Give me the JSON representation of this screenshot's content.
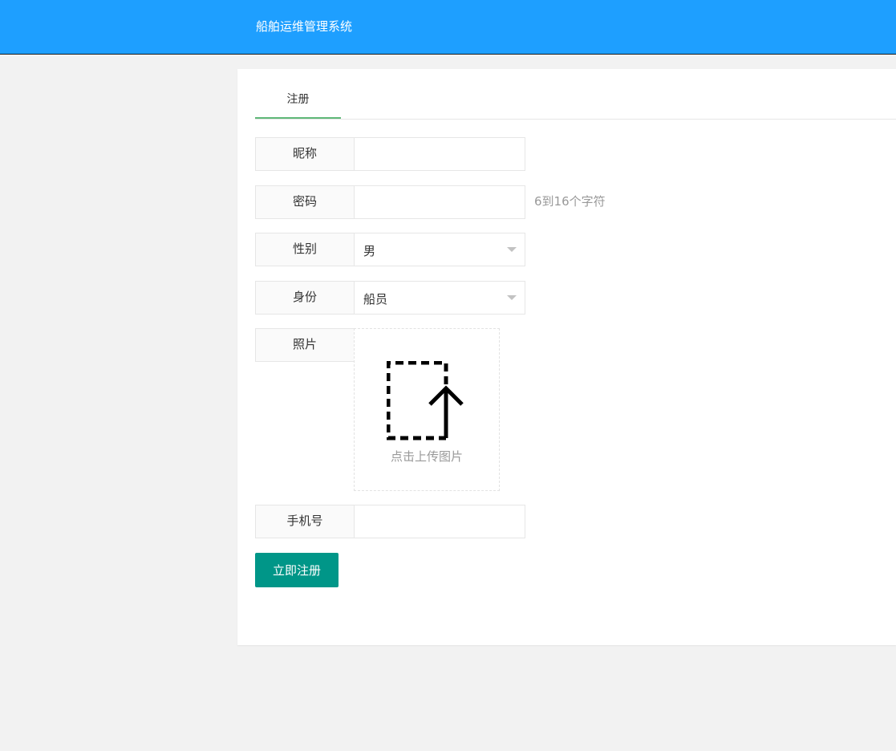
{
  "header": {
    "title": "船舶运维管理系统"
  },
  "tabs": [
    {
      "label": "注册",
      "active": true
    }
  ],
  "form": {
    "nickname": {
      "label": "昵称",
      "value": ""
    },
    "password": {
      "label": "密码",
      "value": "",
      "hint": "6到16个字符"
    },
    "gender": {
      "label": "性别",
      "selected": "男"
    },
    "role": {
      "label": "身份",
      "selected": "船员"
    },
    "photo": {
      "label": "照片",
      "upload_text": "点击上传图片",
      "icon": "upload-icon"
    },
    "phone": {
      "label": "手机号",
      "value": ""
    },
    "submit_label": "立即注册"
  },
  "colors": {
    "header_bg": "#1e9fff",
    "tab_underline": "#5fb878",
    "button_bg": "#009688",
    "page_bg": "#f2f2f2"
  }
}
